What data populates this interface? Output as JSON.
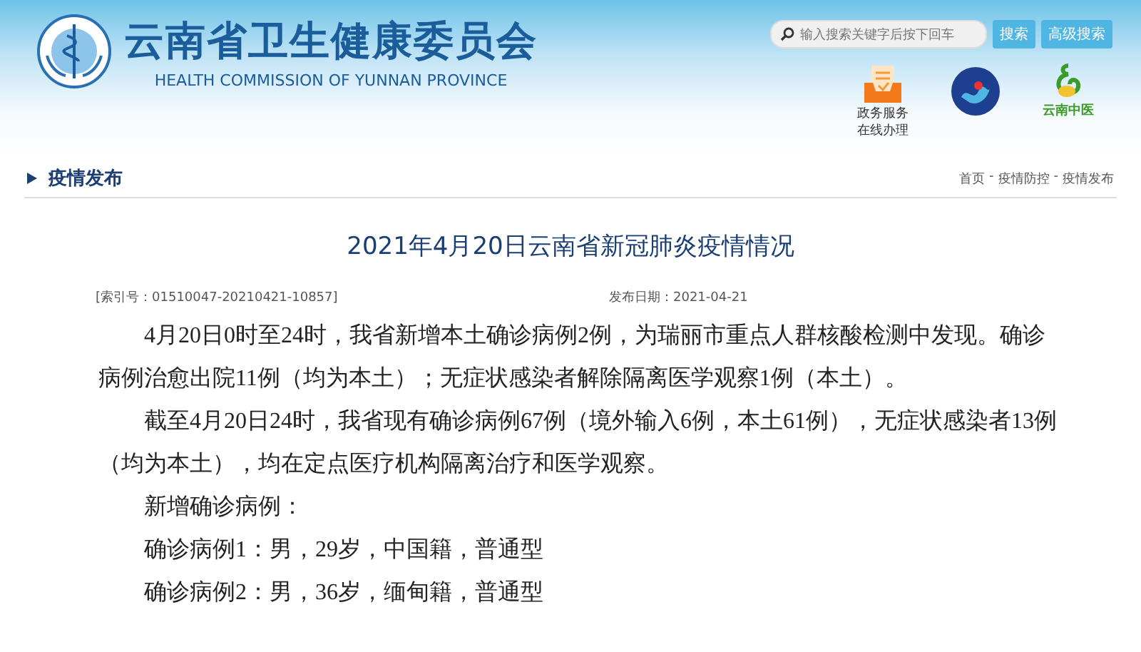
{
  "header": {
    "title": "云南省卫生健康委员会",
    "subtitle": "HEALTH COMMISSION OF YUNNAN PROVINCE",
    "search": {
      "placeholder": "输入搜索关键字后按下回车"
    },
    "buttons": [
      "搜索",
      "高级搜索"
    ],
    "links": [
      {
        "kind": "service",
        "label": "政务服务在线办理"
      },
      {
        "kind": "emblem"
      },
      {
        "kind": "tcm",
        "label": "云南中医"
      }
    ]
  },
  "section": {
    "title": "疫情发布",
    "breadcrumb": [
      "首页",
      "疫情防控",
      "疫情发布"
    ],
    "separator": "-"
  },
  "article": {
    "title": "2021年4月20日云南省新冠肺炎疫情情况",
    "index": "[索引号：01510047-20210421-10857]",
    "date": "发布日期：2021-04-21",
    "paragraphs": [
      "4月20日0时至24时，我省新增本土确诊病例2例，为瑞丽市重点人群核酸检测中发现。确诊病例治愈出院11例（均为本土）；无症状感染者解除隔离医学观察1例（本土）。",
      "截至4月20日24时，我省现有确诊病例67例（境外输入6例，本土61例），无症状感染者13例（均为本土），均在定点医疗机构隔离治疗和医学观察。",
      "新增确诊病例：",
      "确诊病例1：男，29岁，中国籍，普通型",
      "确诊病例2：男，36岁，缅甸籍，普通型"
    ]
  }
}
